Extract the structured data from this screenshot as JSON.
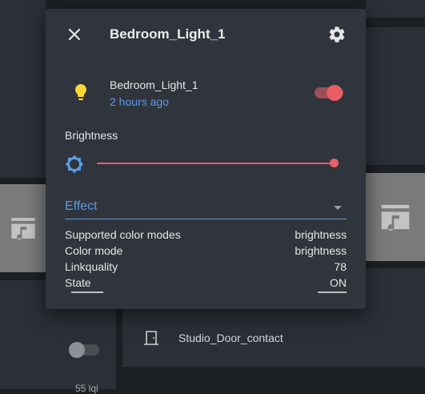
{
  "dialog": {
    "title": "Bedroom_Light_1"
  },
  "entity": {
    "name": "Bedroom_Light_1",
    "last_changed": "2 hours ago",
    "state_on": true
  },
  "brightness": {
    "label": "Brightness",
    "value_fraction": 1.0
  },
  "effect": {
    "label": "Effect"
  },
  "attributes": [
    {
      "key": "Supported color modes",
      "value": "brightness"
    },
    {
      "key": "Color mode",
      "value": "brightness"
    },
    {
      "key": "Linkquality",
      "value": "78"
    },
    {
      "key": "State",
      "value": "ON"
    }
  ],
  "background": {
    "door_contact_label": "Studio_Door_contact",
    "lqi_text": "55 lqi"
  },
  "colors": {
    "accent_blue": "#5b9be6",
    "toggle_on": "#e85d64",
    "bulb_on": "#fdd835",
    "dialog_bg": "#30343c"
  },
  "icons": {
    "close": "close-icon",
    "settings": "gear-icon",
    "bulb": "lightbulb-icon",
    "brightness": "brightness-icon",
    "door": "door-icon",
    "media": "film-music-icon"
  }
}
